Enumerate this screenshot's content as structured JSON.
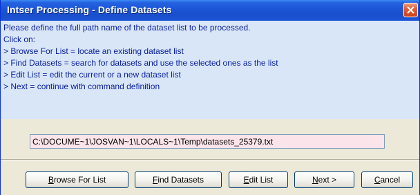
{
  "window": {
    "title": "Intser Processing - Define Datasets"
  },
  "instructions": [
    "Please define the full path name of the dataset list to be processed.",
    "Click on:",
    "> Browse For List = locate an existing dataset list",
    "> Find Datasets = search for datasets and use the selected ones as the list",
    "> Edit List = edit the current or a new dataset list",
    "> Next = continue with command definition"
  ],
  "path_field": {
    "value": "C:\\DOCUME~1\\JOSVAN~1\\LOCALS~1\\Temp\\datasets_25379.txt"
  },
  "buttons": {
    "browse": {
      "mnemonic": "B",
      "rest": "rowse For List"
    },
    "find": {
      "mnemonic": "F",
      "rest": "ind Datasets"
    },
    "edit": {
      "mnemonic": "E",
      "rest": "dit List"
    },
    "next": {
      "mnemonic": "N",
      "rest": "ext >"
    },
    "cancel": {
      "mnemonic": "C",
      "rest": "ancel"
    }
  },
  "colors": {
    "title_bar": "#1b55d6",
    "info_panel_bg": "#d8e6f8",
    "info_text": "#0a1ea0",
    "path_field_bg": "#fbe4ea",
    "dialog_bg": "#ece9d8",
    "close_button": "#e0603a"
  },
  "icons": {
    "close": "close-icon"
  }
}
